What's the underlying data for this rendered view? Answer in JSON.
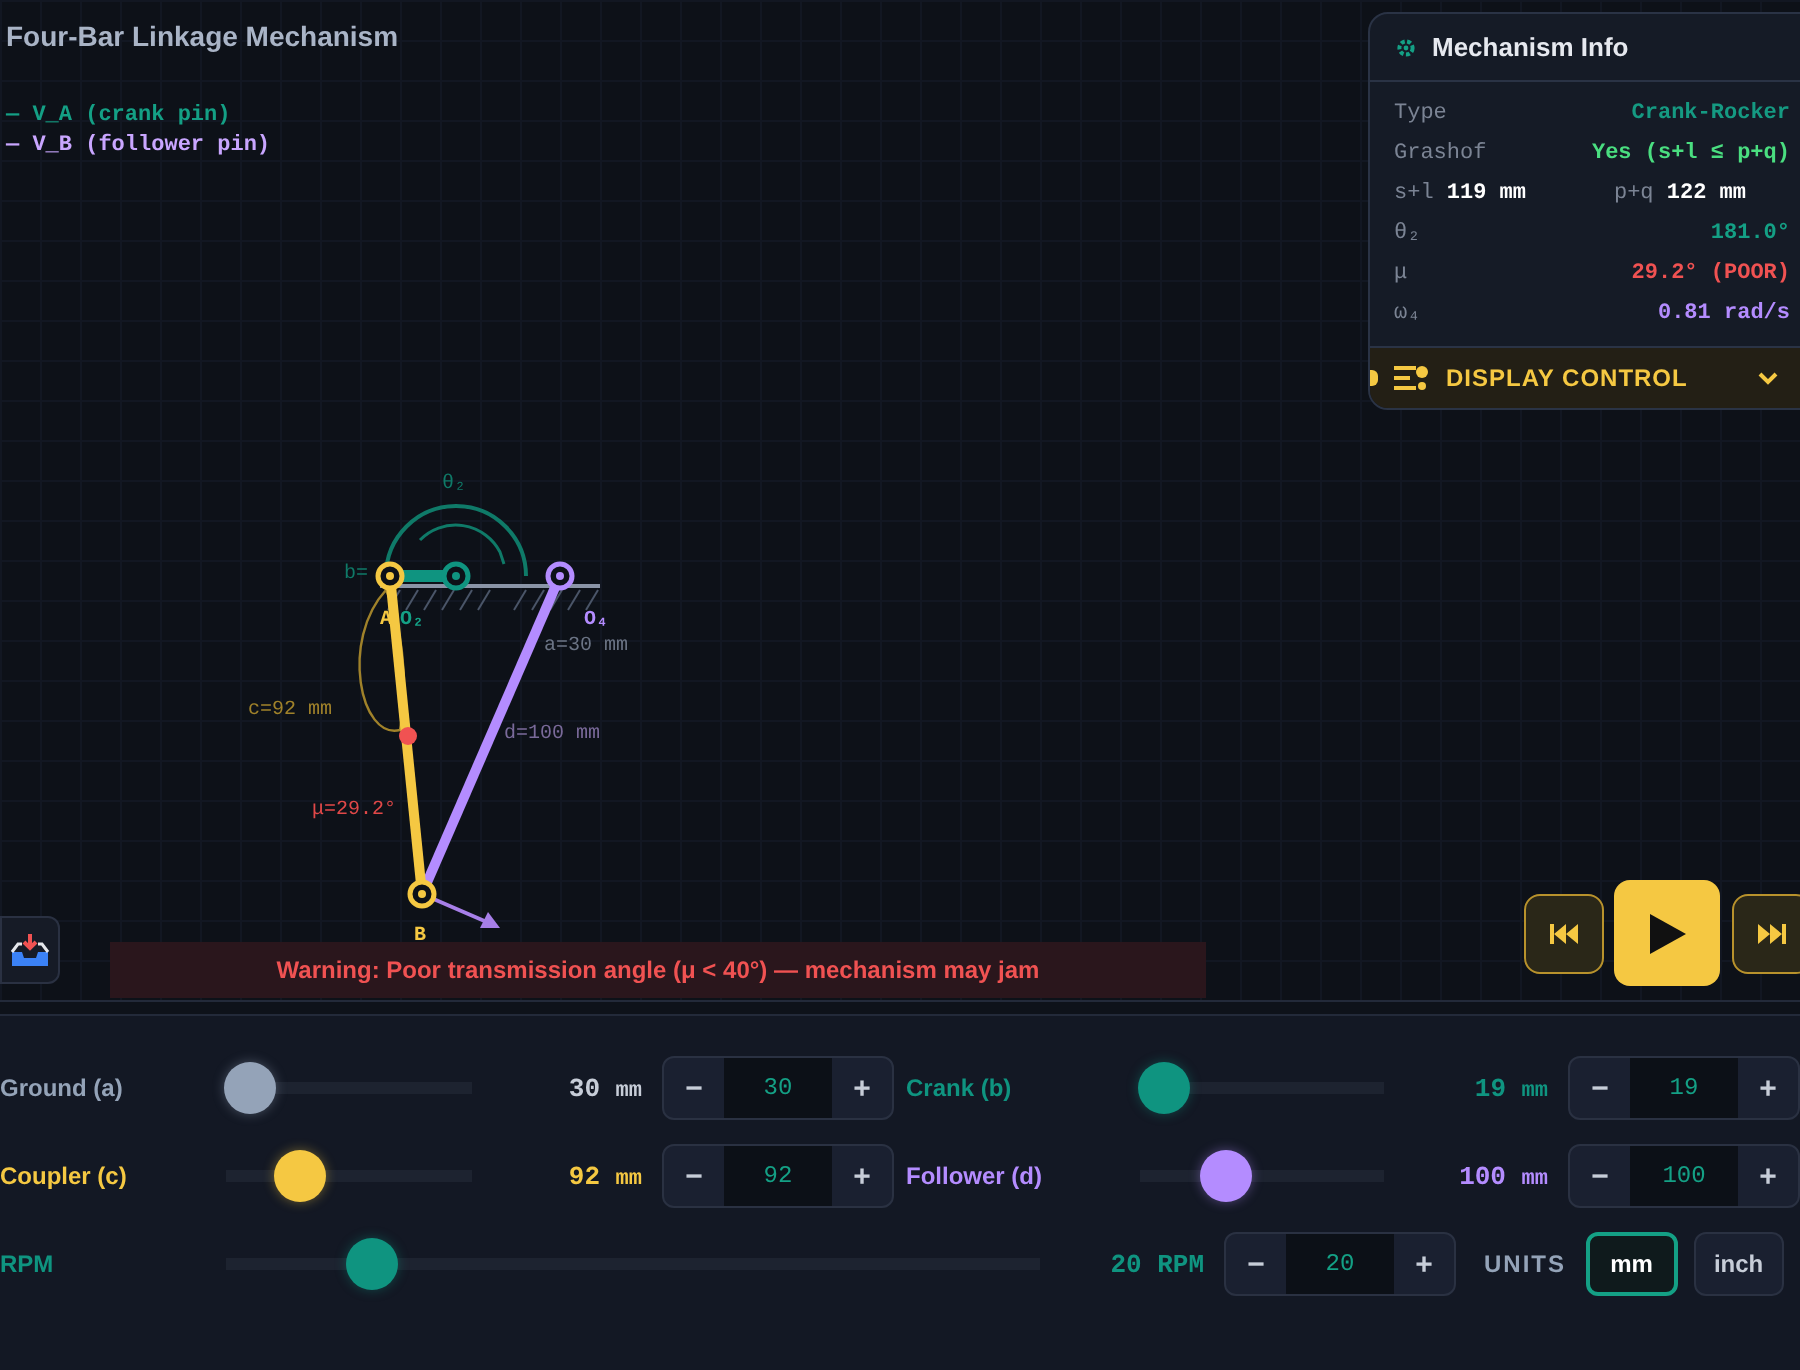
{
  "title": "Four-Bar Linkage Mechanism",
  "legend": [
    {
      "label": "— V_A (crank pin)",
      "color": "#14a085"
    },
    {
      "label": "— V_B (follower pin)",
      "color": "#c9a6ff"
    }
  ],
  "diagram": {
    "theta_label": "θ₂",
    "b_label": "b=",
    "a_point": "A",
    "o2_label": "O₂",
    "o4_label": "O₄",
    "a_label": "a=30 mm",
    "c_label": "c=92 mm",
    "d_label": "d=100 mm",
    "mu_label": "μ=29.2°",
    "b_point": "B"
  },
  "info": {
    "title": "Mechanism Info",
    "rows": [
      {
        "kind": "pair",
        "label": "Type",
        "value": "Crank-Rocker",
        "color": "#159a82"
      },
      {
        "kind": "pair",
        "label": "Grashof",
        "value": "Yes (s+l ≤ p+q)",
        "color": "#4ade80"
      },
      {
        "kind": "sums",
        "label": "s+l",
        "value": "119",
        "unit": "mm",
        "label2": "p+q",
        "value2": "122",
        "unit2": "mm"
      },
      {
        "kind": "pair",
        "label": "θ₂",
        "value": "181.0°",
        "color": "#14a085"
      },
      {
        "kind": "pair",
        "label": "μ",
        "value": "29.2° (POOR)",
        "color": "#f05252"
      },
      {
        "kind": "pair",
        "label": "ω₄",
        "value": "0.81 rad/s",
        "color": "#b48cff"
      }
    ],
    "display_control": {
      "label": "DISPLAY CONTROL",
      "expanded": false
    }
  },
  "warning": "Warning: Poor transmission angle (μ < 40°) — mechanism may jam",
  "sliders": [
    {
      "label": "Ground (a)",
      "color": "#94a3b8",
      "level": 0.1,
      "reading": "30",
      "unit": "mm",
      "value": "30",
      "decrement": "−",
      "increment": "+"
    },
    {
      "label": "Crank (b)",
      "color": "#0f9480",
      "level": 0.1,
      "reading": "19",
      "unit": "mm",
      "value": "19",
      "decrement": "−",
      "increment": "+"
    },
    {
      "label": "Coupler (c)",
      "color": "#f5c842",
      "level": 0.3,
      "reading": "92",
      "unit": "mm",
      "value": "92",
      "decrement": "−",
      "increment": "+"
    },
    {
      "label": "Follower (d)",
      "color": "#b48cff",
      "level": 0.35,
      "reading": "100",
      "unit": "mm",
      "value": "100",
      "decrement": "−",
      "increment": "+"
    }
  ],
  "rpm": {
    "label": "RPM",
    "color": "#0f9480",
    "level": 0.18,
    "reading": "20 RPM",
    "value": "20",
    "decrement": "−",
    "increment": "+"
  },
  "units": {
    "label": "UNITS",
    "options": [
      {
        "label": "mm",
        "selected": true
      },
      {
        "label": "inch",
        "selected": false
      }
    ]
  }
}
